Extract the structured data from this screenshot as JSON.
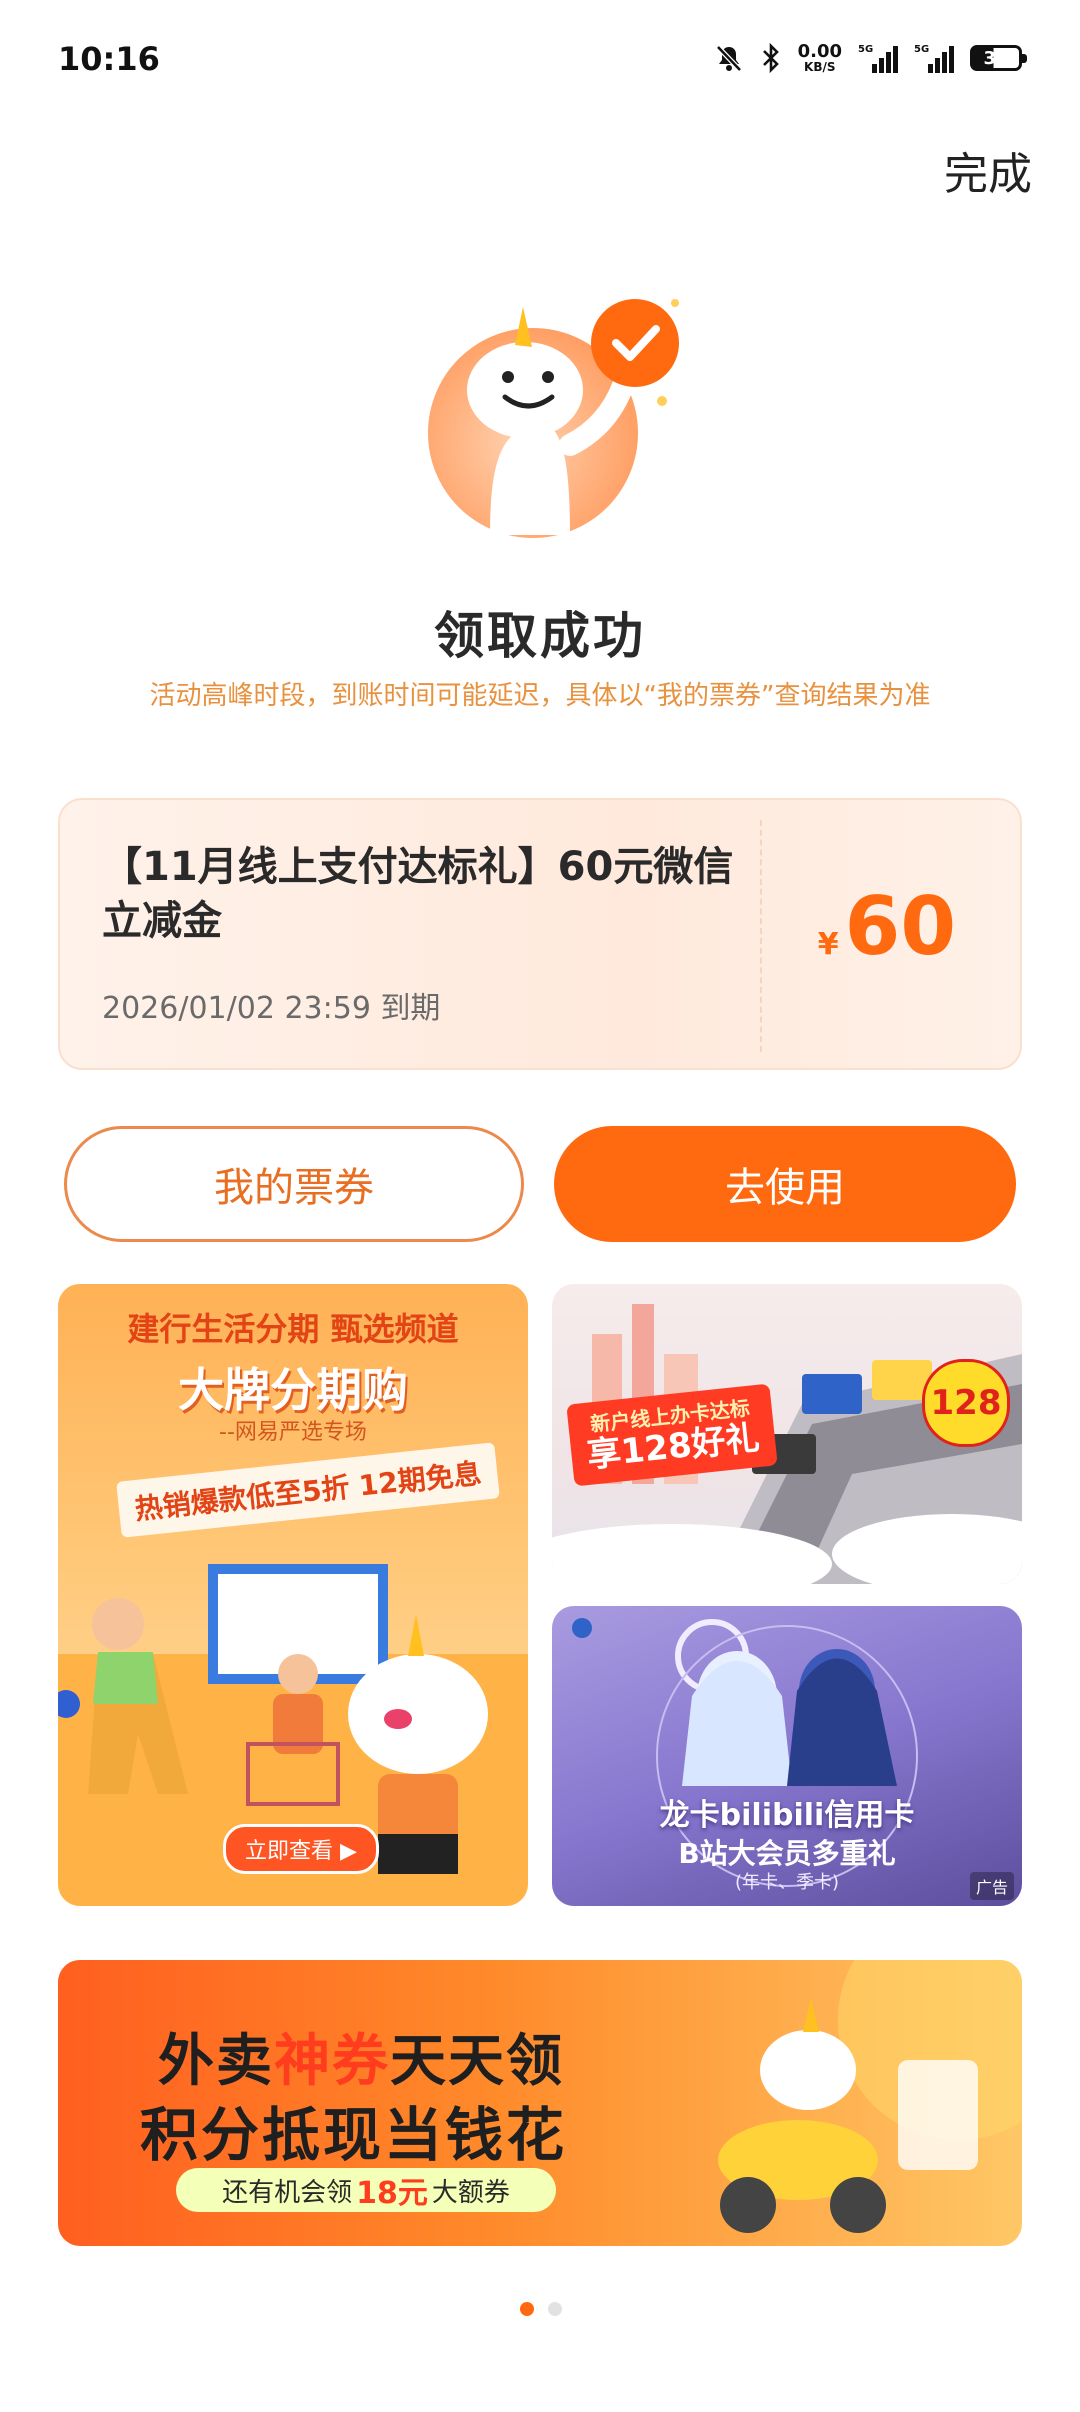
{
  "status_bar": {
    "time": "10:16",
    "net_speed": "0.00",
    "net_unit": "KB/S",
    "sim1": "5G",
    "sim2": "5G",
    "battery": "39"
  },
  "header": {
    "done_label": "完成"
  },
  "result": {
    "title": "领取成功",
    "notice": "活动高峰时段，到账时间可能延迟，具体以“我的票券”查询结果为准"
  },
  "coupon": {
    "name": "【11月线上支付达标礼】60元微信立减金",
    "expiry": "2026/01/02 23:59 到期",
    "currency": "¥",
    "amount": "60"
  },
  "actions": {
    "my_tickets": "我的票券",
    "use_now": "去使用"
  },
  "banners": {
    "b1": {
      "line1": "建行生活分期 甄选频道",
      "line2": "大牌分期购",
      "line3": "--网易严选专场",
      "ribbon": "热销爆款低至5折 12期免息",
      "cta": "立即查看 ▶"
    },
    "b2": {
      "tag_main": "享128好礼",
      "tag_small": "新户线上办卡达标",
      "badge": "128"
    },
    "b3": {
      "title": "龙卡bilibili信用卡",
      "subtitle": "B站大会员多重礼",
      "note": "(年卡、季卡)",
      "ad": "广告"
    },
    "b4": {
      "l1_a": "外卖",
      "l1_hl": "神券",
      "l1_b": "天天领",
      "l2": "积分抵现当钱花",
      "pill_a": "还有机会领",
      "pill_hl": "18元",
      "pill_b": "大额券"
    }
  },
  "pager": {
    "count": 2,
    "active": 0
  },
  "colors": {
    "accent": "#ff6a10",
    "notice": "#e8913e"
  }
}
